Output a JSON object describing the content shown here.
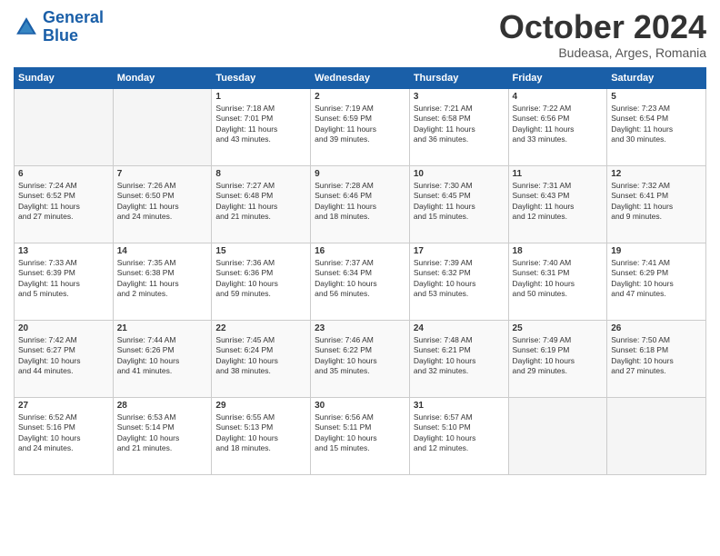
{
  "header": {
    "logo_line1": "General",
    "logo_line2": "Blue",
    "month_title": "October 2024",
    "location": "Budeasa, Arges, Romania"
  },
  "days_of_week": [
    "Sunday",
    "Monday",
    "Tuesday",
    "Wednesday",
    "Thursday",
    "Friday",
    "Saturday"
  ],
  "weeks": [
    [
      {
        "day": "",
        "content": ""
      },
      {
        "day": "",
        "content": ""
      },
      {
        "day": "1",
        "content": "Sunrise: 7:18 AM\nSunset: 7:01 PM\nDaylight: 11 hours\nand 43 minutes."
      },
      {
        "day": "2",
        "content": "Sunrise: 7:19 AM\nSunset: 6:59 PM\nDaylight: 11 hours\nand 39 minutes."
      },
      {
        "day": "3",
        "content": "Sunrise: 7:21 AM\nSunset: 6:58 PM\nDaylight: 11 hours\nand 36 minutes."
      },
      {
        "day": "4",
        "content": "Sunrise: 7:22 AM\nSunset: 6:56 PM\nDaylight: 11 hours\nand 33 minutes."
      },
      {
        "day": "5",
        "content": "Sunrise: 7:23 AM\nSunset: 6:54 PM\nDaylight: 11 hours\nand 30 minutes."
      }
    ],
    [
      {
        "day": "6",
        "content": "Sunrise: 7:24 AM\nSunset: 6:52 PM\nDaylight: 11 hours\nand 27 minutes."
      },
      {
        "day": "7",
        "content": "Sunrise: 7:26 AM\nSunset: 6:50 PM\nDaylight: 11 hours\nand 24 minutes."
      },
      {
        "day": "8",
        "content": "Sunrise: 7:27 AM\nSunset: 6:48 PM\nDaylight: 11 hours\nand 21 minutes."
      },
      {
        "day": "9",
        "content": "Sunrise: 7:28 AM\nSunset: 6:46 PM\nDaylight: 11 hours\nand 18 minutes."
      },
      {
        "day": "10",
        "content": "Sunrise: 7:30 AM\nSunset: 6:45 PM\nDaylight: 11 hours\nand 15 minutes."
      },
      {
        "day": "11",
        "content": "Sunrise: 7:31 AM\nSunset: 6:43 PM\nDaylight: 11 hours\nand 12 minutes."
      },
      {
        "day": "12",
        "content": "Sunrise: 7:32 AM\nSunset: 6:41 PM\nDaylight: 11 hours\nand 9 minutes."
      }
    ],
    [
      {
        "day": "13",
        "content": "Sunrise: 7:33 AM\nSunset: 6:39 PM\nDaylight: 11 hours\nand 5 minutes."
      },
      {
        "day": "14",
        "content": "Sunrise: 7:35 AM\nSunset: 6:38 PM\nDaylight: 11 hours\nand 2 minutes."
      },
      {
        "day": "15",
        "content": "Sunrise: 7:36 AM\nSunset: 6:36 PM\nDaylight: 10 hours\nand 59 minutes."
      },
      {
        "day": "16",
        "content": "Sunrise: 7:37 AM\nSunset: 6:34 PM\nDaylight: 10 hours\nand 56 minutes."
      },
      {
        "day": "17",
        "content": "Sunrise: 7:39 AM\nSunset: 6:32 PM\nDaylight: 10 hours\nand 53 minutes."
      },
      {
        "day": "18",
        "content": "Sunrise: 7:40 AM\nSunset: 6:31 PM\nDaylight: 10 hours\nand 50 minutes."
      },
      {
        "day": "19",
        "content": "Sunrise: 7:41 AM\nSunset: 6:29 PM\nDaylight: 10 hours\nand 47 minutes."
      }
    ],
    [
      {
        "day": "20",
        "content": "Sunrise: 7:42 AM\nSunset: 6:27 PM\nDaylight: 10 hours\nand 44 minutes."
      },
      {
        "day": "21",
        "content": "Sunrise: 7:44 AM\nSunset: 6:26 PM\nDaylight: 10 hours\nand 41 minutes."
      },
      {
        "day": "22",
        "content": "Sunrise: 7:45 AM\nSunset: 6:24 PM\nDaylight: 10 hours\nand 38 minutes."
      },
      {
        "day": "23",
        "content": "Sunrise: 7:46 AM\nSunset: 6:22 PM\nDaylight: 10 hours\nand 35 minutes."
      },
      {
        "day": "24",
        "content": "Sunrise: 7:48 AM\nSunset: 6:21 PM\nDaylight: 10 hours\nand 32 minutes."
      },
      {
        "day": "25",
        "content": "Sunrise: 7:49 AM\nSunset: 6:19 PM\nDaylight: 10 hours\nand 29 minutes."
      },
      {
        "day": "26",
        "content": "Sunrise: 7:50 AM\nSunset: 6:18 PM\nDaylight: 10 hours\nand 27 minutes."
      }
    ],
    [
      {
        "day": "27",
        "content": "Sunrise: 6:52 AM\nSunset: 5:16 PM\nDaylight: 10 hours\nand 24 minutes."
      },
      {
        "day": "28",
        "content": "Sunrise: 6:53 AM\nSunset: 5:14 PM\nDaylight: 10 hours\nand 21 minutes."
      },
      {
        "day": "29",
        "content": "Sunrise: 6:55 AM\nSunset: 5:13 PM\nDaylight: 10 hours\nand 18 minutes."
      },
      {
        "day": "30",
        "content": "Sunrise: 6:56 AM\nSunset: 5:11 PM\nDaylight: 10 hours\nand 15 minutes."
      },
      {
        "day": "31",
        "content": "Sunrise: 6:57 AM\nSunset: 5:10 PM\nDaylight: 10 hours\nand 12 minutes."
      },
      {
        "day": "",
        "content": ""
      },
      {
        "day": "",
        "content": ""
      }
    ]
  ]
}
